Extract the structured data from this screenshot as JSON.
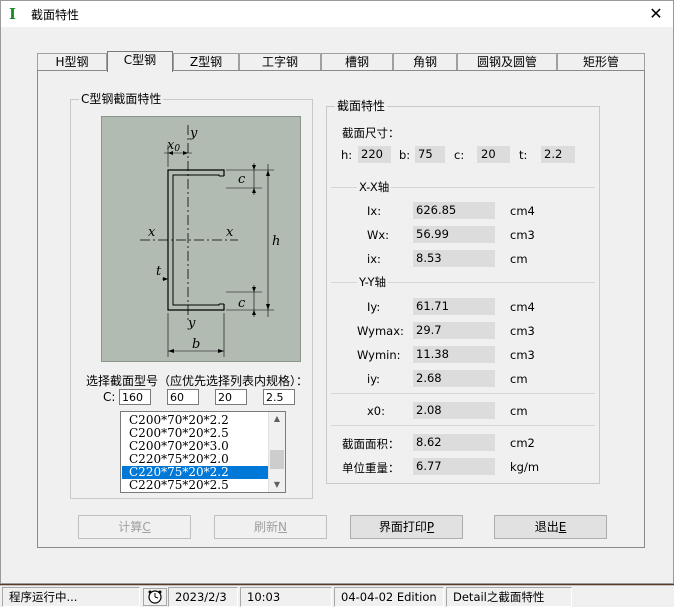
{
  "window": {
    "title": "截面特性",
    "close_symbol": "✕"
  },
  "tabs": [
    {
      "label": "H型钢"
    },
    {
      "label": "C型钢"
    },
    {
      "label": "Z型钢"
    },
    {
      "label": "工字钢"
    },
    {
      "label": "槽钢"
    },
    {
      "label": "角钢"
    },
    {
      "label": "圆钢及圆管"
    },
    {
      "label": "矩形管"
    }
  ],
  "active_tab": "C型钢",
  "left_group": {
    "title": "C型钢截面特性",
    "diagram": {
      "labels": {
        "y_top": "y",
        "x0": "x0",
        "x0_base": "x",
        "x0_sub": "0",
        "c_top": "c",
        "x_left": "x",
        "x_right": "x",
        "h": "h",
        "t": "t",
        "c_bottom": "c",
        "y_bottom": "y",
        "b": "b"
      }
    },
    "select_label": "选择截面型号（应优先选择列表内规格）：",
    "c_label": "C:",
    "inputs": [
      "160",
      "60",
      "20",
      "2.5"
    ],
    "list_items": [
      "C200*70*20*2.2",
      "C200*70*20*2.5",
      "C200*70*20*3.0",
      "C220*75*20*2.0",
      "C220*75*20*2.2",
      "C220*75*20*2.5"
    ],
    "selected_item": "C220*75*20*2.2",
    "scroll": {
      "up": "▲",
      "down": "▼"
    }
  },
  "right_group": {
    "title": "截面特性",
    "dim_header": "截面尺寸：",
    "dims": [
      {
        "label": "h:",
        "value": "220"
      },
      {
        "label": "b:",
        "value": "75"
      },
      {
        "label": "c:",
        "value": "20"
      },
      {
        "label": "t:",
        "value": "2.2"
      }
    ],
    "xx_axis": "X-X轴",
    "xx_props": [
      {
        "label": "Ix:",
        "value": "626.85",
        "unit": "cm4"
      },
      {
        "label": "Wx:",
        "value": "56.99",
        "unit": "cm3"
      },
      {
        "label": "ix:",
        "value": "8.53",
        "unit": "cm"
      }
    ],
    "yy_axis": "Y-Y轴",
    "yy_props": [
      {
        "label": "Iy:",
        "value": "61.71",
        "unit": "cm4"
      },
      {
        "label": "Wymax:",
        "value": "29.7",
        "unit": "cm3"
      },
      {
        "label": "Wymin:",
        "value": "11.38",
        "unit": "cm3"
      },
      {
        "label": "iy:",
        "value": "2.68",
        "unit": "cm"
      }
    ],
    "x0": {
      "label": "x0:",
      "value": "2.08",
      "unit": "cm"
    },
    "area": {
      "label": "截面面积：",
      "value": "8.62",
      "unit": "cm2"
    },
    "weight": {
      "label": "单位重量：",
      "value": "6.77",
      "unit": "kg/m"
    }
  },
  "buttons": {
    "calc": {
      "text": "计算",
      "key": "C"
    },
    "refresh": {
      "text": "刷新",
      "key": "N"
    },
    "print": {
      "text": "界面打印",
      "key": "P"
    },
    "exit": {
      "text": "退出",
      "key": "E"
    }
  },
  "status": {
    "running": "程序运行中...",
    "date": "2023/2/3",
    "time": "10:03",
    "edition": "04-04-02 Edition",
    "module": "Detail之截面特性"
  },
  "colors": {
    "selection": "#0078d7",
    "diagram_bg": "#b2bbb2",
    "app_icon": "#1a8a2a"
  }
}
